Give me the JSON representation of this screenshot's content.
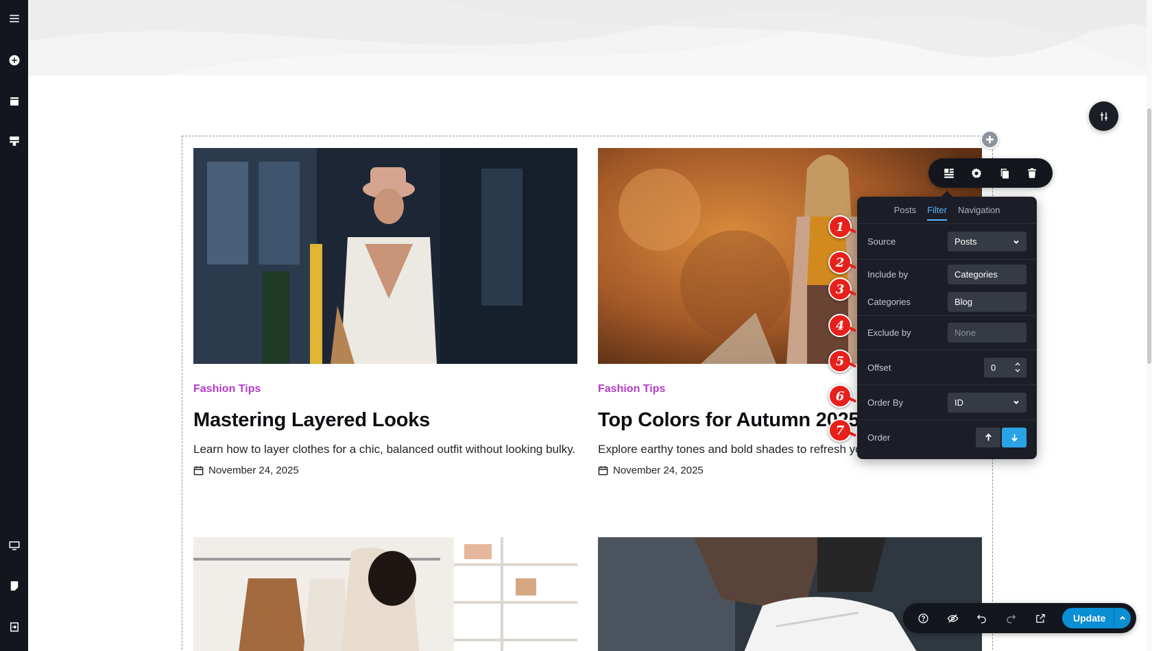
{
  "rail": {
    "items": [
      {
        "icon": "menu-icon"
      },
      {
        "icon": "add-circle-icon"
      },
      {
        "icon": "layers-icon"
      },
      {
        "icon": "template-icon"
      },
      {
        "icon": "desktop-icon"
      },
      {
        "icon": "page-icon"
      },
      {
        "icon": "exit-icon"
      }
    ]
  },
  "cards": [
    {
      "category": "Fashion Tips",
      "title": "Mastering Layered Looks",
      "excerpt": "Learn how to layer clothes for a chic, balanced outfit without looking bulky.",
      "date": "November 24, 2025"
    },
    {
      "category": "Fashion Tips",
      "title": "Top Colors for Autumn 2025",
      "excerpt": "Explore earthy tones and bold shades to refresh your autumn wardrobe.",
      "date": "November 24, 2025"
    }
  ],
  "toolbar": {
    "buttons": [
      "grid-layout-icon",
      "settings-icon",
      "duplicate-icon",
      "trash-icon"
    ]
  },
  "panel": {
    "tabs": [
      "Posts",
      "Filter",
      "Navigation"
    ],
    "active_tab": "Filter",
    "fields": {
      "source": {
        "label": "Source",
        "value": "Posts"
      },
      "include_by": {
        "label": "Include by",
        "value": "Categories"
      },
      "categories": {
        "label": "Categories",
        "value": "Blog"
      },
      "exclude_by": {
        "label": "Exclude by",
        "value": "None"
      },
      "offset": {
        "label": "Offset",
        "value": "0"
      },
      "order_by": {
        "label": "Order By",
        "value": "ID"
      },
      "order": {
        "label": "Order",
        "selected": "descending"
      }
    }
  },
  "markers": [
    "1",
    "2",
    "3",
    "4",
    "5",
    "6",
    "7"
  ],
  "bottombar": {
    "update_label": "Update",
    "buttons": [
      "help-icon",
      "visibility-off-icon",
      "undo-icon",
      "redo-icon",
      "external-link-icon"
    ]
  },
  "colors": {
    "category": "#b43bc9",
    "accent": "#5ab5ff",
    "update": "#0a8ed4",
    "marker": "#e8201b"
  }
}
